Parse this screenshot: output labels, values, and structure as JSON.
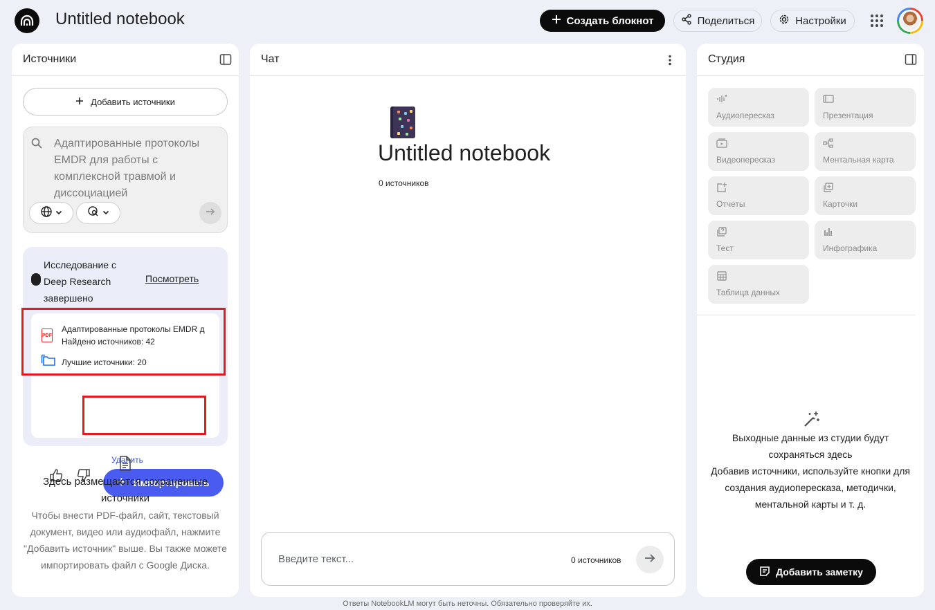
{
  "header": {
    "title": "Untitled notebook",
    "create_label": "Создать блокнот",
    "share_label": "Поделиться",
    "settings_label": "Настройки"
  },
  "sources": {
    "title": "Источники",
    "add_label": "Добавить источники",
    "search_placeholder": "Адаптированные протоколы EMDR для работы с комплексной травмой и диссоциацией",
    "research": {
      "status": "Исследование с Deep Research завершено",
      "view_label": "Посмотреть",
      "result_name": "Адаптированные протоколы EMDR д",
      "found_count": "Найдено источников: 42",
      "best_count": "Лучшие источники: 20",
      "delete_label": "Удалить",
      "import_label": "Импортировать"
    },
    "empty_title": "Здесь размещаются сохраненные источники",
    "empty_desc": "Чтобы внести PDF-файл, сайт, текстовый документ, видео или аудиофайл, нажмите \"Добавить источник\" выше. Вы также можете импортировать файл с Google Диска."
  },
  "chat": {
    "title": "Чат",
    "notebook_title": "Untitled notebook",
    "source_count": "0 источников",
    "input_placeholder": "Введите текст...",
    "input_source_count": "0 источников"
  },
  "studio": {
    "title": "Студия",
    "tiles": [
      {
        "label": "Аудиопересказ",
        "icon": "audio-wave-icon"
      },
      {
        "label": "Презентация",
        "icon": "slides-icon"
      },
      {
        "label": "Видеопересказ",
        "icon": "video-icon"
      },
      {
        "label": "Ментальная карта",
        "icon": "mind-map-icon"
      },
      {
        "label": "Отчеты",
        "icon": "report-icon"
      },
      {
        "label": "Карточки",
        "icon": "flashcards-icon"
      },
      {
        "label": "Тест",
        "icon": "quiz-icon"
      },
      {
        "label": "Инфографика",
        "icon": "infographic-icon"
      },
      {
        "label": "Таблица данных",
        "icon": "table-icon"
      }
    ],
    "empty_title": "Выходные данные из студии будут сохраняться здесь",
    "empty_desc": "Добавив источники, используйте кнопки для создания аудиопересказа, методички, ментальной карты и т. д.",
    "add_note_label": "Добавить заметку"
  },
  "footer": "Ответы NotebookLM могут быть неточны. Обязательно проверяйте их.",
  "colors": {
    "accent": "#4a5cf0",
    "highlight": "#e01d1d",
    "dark": "#0b0b0b",
    "background": "#eef0f7"
  }
}
